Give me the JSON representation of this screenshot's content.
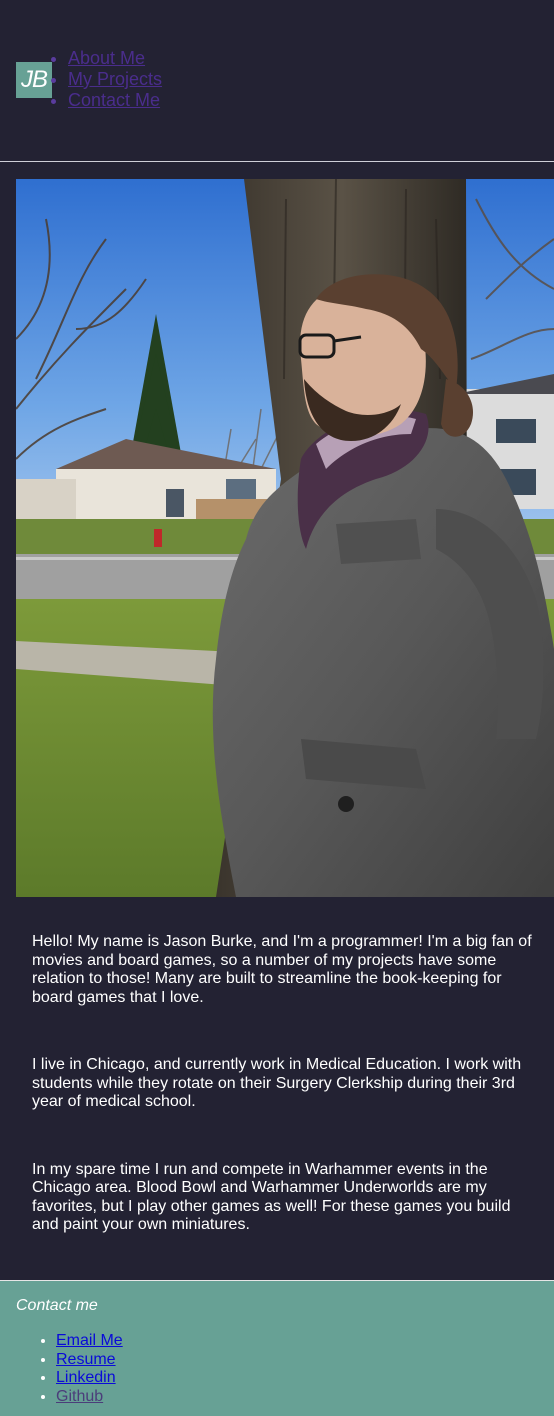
{
  "header": {
    "logo_text": "JB",
    "nav": [
      {
        "label": "About Me"
      },
      {
        "label": "My Projects"
      },
      {
        "label": "Contact Me"
      }
    ]
  },
  "hero": {
    "image": "portrait-photo"
  },
  "about": {
    "paragraphs": [
      "Hello! My name is Jason Burke, and I'm a programmer! I'm a big fan of movies and board games, so a number of my projects have some relation to those! Many are built to streamline the book-keeping for board games that I love.",
      "I live in Chicago, and currently work in Medical Education. I work with students while they rotate on their Surgery Clerkship during their 3rd year of medical school.",
      "In my spare time I run and compete in Warhammer events in the Chicago area. Blood Bowl and Warhammer Underworlds are my favorites, but I play other games as well! For these games you build and paint your own miniatures."
    ]
  },
  "footer": {
    "title": "Contact me",
    "links": [
      {
        "label": "Email Me"
      },
      {
        "label": "Resume"
      },
      {
        "label": "Linkedin"
      },
      {
        "label": "Github"
      }
    ]
  },
  "colors": {
    "background": "#232233",
    "accent": "#67a195",
    "nav_link": "#4a2d8c",
    "footer_link": "#0a0ad8"
  }
}
